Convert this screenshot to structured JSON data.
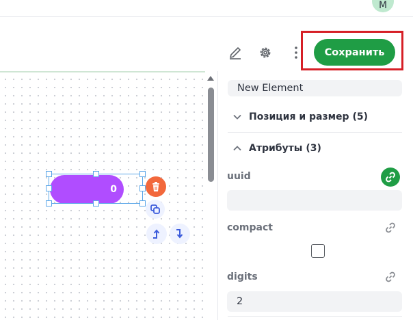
{
  "header": {
    "avatar_initial": "M"
  },
  "toolbar": {
    "save_label": "Сохранить",
    "icons": [
      "pencil-icon",
      "gear-icon",
      "kebab-icon"
    ]
  },
  "canvas": {
    "element": {
      "label": "0",
      "color": "#b04dff"
    },
    "actions": [
      "trash-icon",
      "copy-icon",
      "move-up-icon",
      "move-down-icon"
    ]
  },
  "panel": {
    "element_name": "New Element",
    "sections": {
      "position": {
        "label": "Позиция и размер (5)",
        "expanded": false
      },
      "attributes": {
        "label": "Атрибуты (3)",
        "expanded": true
      }
    },
    "attributes": [
      {
        "label": "uuid",
        "value": "",
        "linked": true
      },
      {
        "label": "compact",
        "checked": false,
        "linked": false
      },
      {
        "label": "digits",
        "value": "2",
        "linked": false
      }
    ]
  },
  "colors": {
    "accent": "#1f9d45",
    "delete": "#f2683c",
    "highlight": "#d61f26"
  }
}
